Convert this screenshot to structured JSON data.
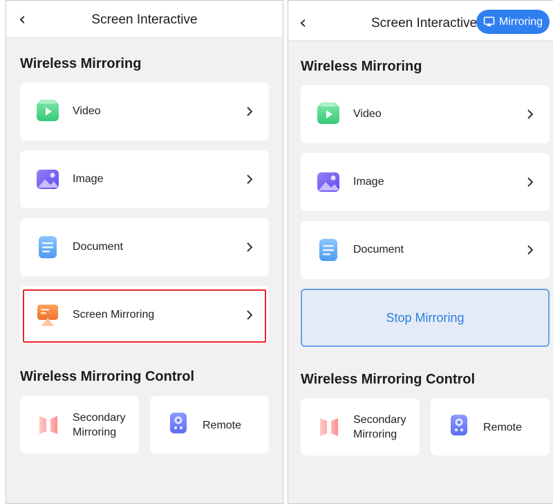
{
  "left": {
    "header": {
      "title": "Screen Interactive",
      "back_icon": "back-chevron-icon"
    },
    "section_title": "Wireless Mirroring",
    "items": [
      {
        "label": "Video",
        "icon": "video-icon",
        "color": "#3fcf7f"
      },
      {
        "label": "Image",
        "icon": "image-icon",
        "color": "#7b63f0"
      },
      {
        "label": "Document",
        "icon": "document-icon",
        "color": "#5aa6f4"
      },
      {
        "label": "Screen Mirroring",
        "icon": "screen-mirroring-icon",
        "color": "#f2883a"
      }
    ],
    "control_title": "Wireless Mirroring Control",
    "controls": [
      {
        "label_line1": "Secondary",
        "label_line2": "Mirroring",
        "icon": "secondary-mirroring-icon"
      },
      {
        "label": "Remote",
        "icon": "remote-icon"
      }
    ]
  },
  "right": {
    "header": {
      "title": "Screen Interactive",
      "status_pill": "Mirroring",
      "back_icon": "back-chevron-icon"
    },
    "section_title": "Wireless Mirroring",
    "items": [
      {
        "label": "Video",
        "icon": "video-icon"
      },
      {
        "label": "Image",
        "icon": "image-icon"
      },
      {
        "label": "Document",
        "icon": "document-icon"
      }
    ],
    "stop_button": "Stop Mirroring",
    "control_title": "Wireless Mirroring Control",
    "controls": [
      {
        "label_line1": "Secondary",
        "label_line2": "Mirroring",
        "icon": "secondary-mirroring-icon"
      },
      {
        "label": "Remote",
        "icon": "remote-icon"
      }
    ]
  },
  "colors": {
    "accent": "#2f7ff1",
    "highlight": "#e8262a",
    "background": "#f1f1f3"
  }
}
